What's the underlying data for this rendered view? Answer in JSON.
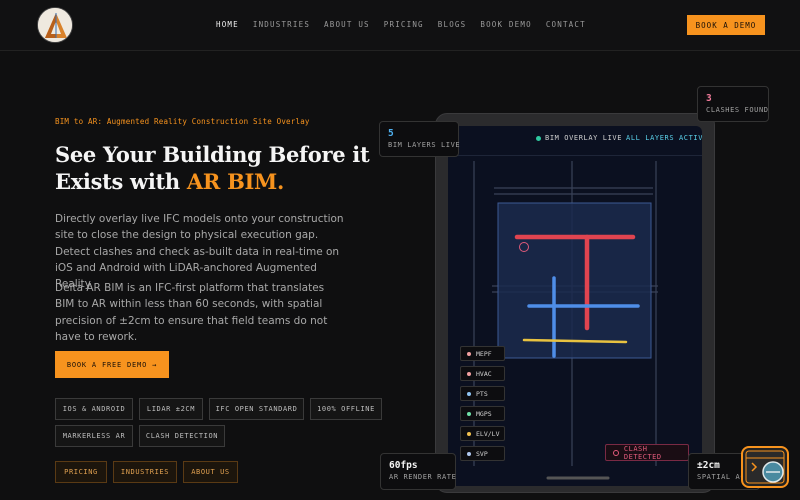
{
  "nav": {
    "links": [
      "HOME",
      "INDUSTRIES",
      "ABOUT US",
      "PRICING",
      "BLOGS",
      "BOOK DEMO",
      "CONTACT"
    ],
    "cta": "BOOK A DEMO"
  },
  "hero": {
    "eyebrow": "BIM to AR: Augmented Reality Construction Site Overlay",
    "title_main": "See Your Building Before it Exists with ",
    "title_accent": "AR BIM.",
    "para1": "Directly overlay live IFC models onto your construction site to close the design to physical execution gap. Detect clashes and check as-built data in real-time on iOS and Android with LiDAR-anchored Augmented Reality.",
    "para2": "Delta AR BIM is an IFC-first platform that translates BIM to AR within less than 60 seconds, with spatial precision of ±2cm to ensure that field teams do not have to rework.",
    "cta": "BOOK A FREE DEMO →",
    "tags": [
      "IOS & ANDROID",
      "LIDAR ±2CM",
      "IFC OPEN STANDARD",
      "100% OFFLINE",
      "MARKERLESS AR",
      "CLASH DETECTION"
    ],
    "links": [
      "PRICING",
      "INDUSTRIES",
      "ABOUT US"
    ]
  },
  "device": {
    "status_label": "BIM OVERLAY LIVE",
    "status_accent": "ALL LAYERS ACTIVE",
    "layers": [
      {
        "label": "MEPF",
        "color": "#f2a0a0"
      },
      {
        "label": "HVAC",
        "color": "#f2a0a0"
      },
      {
        "label": "PTS",
        "color": "#8fc4f2"
      },
      {
        "label": "MGPS",
        "color": "#6fe0a8"
      },
      {
        "label": "ELV/LV",
        "color": "#f2c14e"
      },
      {
        "label": "SVP",
        "color": "#b0c8f0"
      }
    ],
    "clash_badge": "CLASH DETECTED"
  },
  "stats": {
    "layers_num": "5",
    "layers_label": "BIM LAYERS LIVE",
    "clashes_num": "3",
    "clashes_label": "CLASHES FOUND",
    "fps_num": "60fps",
    "fps_label": "AR RENDER RATE",
    "precision_num": "±2cm",
    "precision_label": "SPATIAL ACCURACY"
  },
  "colors": {
    "accent": "#f7931e",
    "background": "#0f0f10",
    "screen": "#0b1020"
  }
}
